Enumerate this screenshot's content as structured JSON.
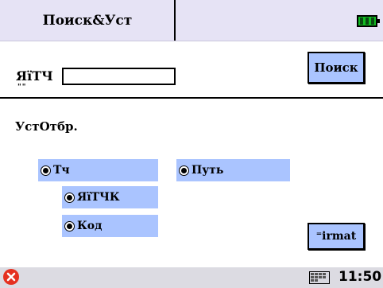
{
  "header": {
    "tab_title": "Поиск&Уст",
    "battery_icon": "battery-full-icon"
  },
  "search": {
    "label": "ЯїТЧ",
    "label_suffix": "\"\"",
    "input_value": "",
    "button_label": "Поиск"
  },
  "settings": {
    "section_title": "УстОтбр.",
    "options": {
      "tch": "Тч",
      "put": "Путь",
      "yatchk": "ЯїТЧК",
      "kod": "Код"
    },
    "format_label": "⁼irmat"
  },
  "taskbar": {
    "close_icon": "close-icon",
    "keyboard_icon": "keyboard-icon",
    "clock": "11:50"
  },
  "colors": {
    "topbar": "#e6e3f5",
    "accent": "#aac4ff",
    "taskbar": "#dcdbe2",
    "close": "#e53020",
    "battery": "#11bb22"
  }
}
